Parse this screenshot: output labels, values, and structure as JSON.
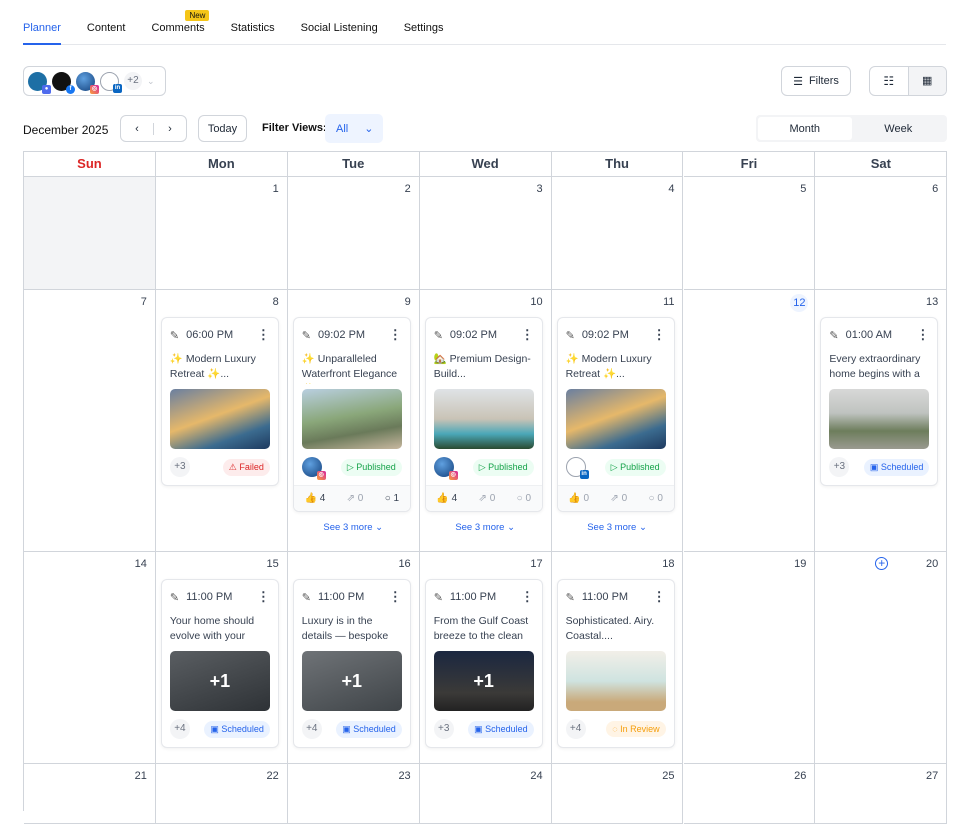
{
  "tabs": [
    {
      "label": "Planner",
      "active": true
    },
    {
      "label": "Content"
    },
    {
      "label": "Comments",
      "badge": "New"
    },
    {
      "label": "Statistics"
    },
    {
      "label": "Social Listening"
    },
    {
      "label": "Settings"
    }
  ],
  "accounts": {
    "more": "+2"
  },
  "toolbar": {
    "filters": "Filters",
    "month_label": "December 2025",
    "today": "Today",
    "filter_views_label": "Filter Views:",
    "filter_views_value": "All",
    "view_month": "Month",
    "view_week": "Week"
  },
  "weekdays": [
    "Sun",
    "Mon",
    "Tue",
    "Wed",
    "Thu",
    "Fri",
    "Sat"
  ],
  "colors": {
    "accent": "#2563eb",
    "sunday": "#dc2626"
  },
  "weeks": [
    {
      "days": [
        {
          "n": ""
        },
        {
          "n": "1"
        },
        {
          "n": "2"
        },
        {
          "n": "3"
        },
        {
          "n": "4"
        },
        {
          "n": "5"
        },
        {
          "n": "6"
        }
      ]
    },
    {
      "days": [
        {
          "n": "7"
        },
        {
          "n": "8",
          "posts": [
            {
              "time": "06:00 PM",
              "text": "✨ Modern Luxury Retreat ✨...",
              "img": "linear-gradient(160deg,#6a7fa0 0%,#e6b86a 45%,#3b6b8f 75%,#1e3a5f 100%)",
              "count": "+3",
              "status": "Failed"
            }
          ]
        },
        {
          "n": "9",
          "posts": [
            {
              "time": "09:02 PM",
              "text": "✨ Unparalleled Waterfront Elegance ✨...",
              "img": "linear-gradient(170deg,#b9cfe0 0%,#8aa77a 45%,#6a7a5a 70%,#c8b8a0 100%)",
              "avatar": "ig",
              "status": "Published",
              "stats": {
                "likes": "4",
                "shares": "0",
                "comments": "1"
              }
            }
          ],
          "see_more": "See 3 more"
        },
        {
          "n": "10",
          "posts": [
            {
              "time": "09:02 PM",
              "text": "🏡 Premium Design-Build...",
              "img": "linear-gradient(180deg,#dfe3e6 0%,#c9c3b6 50%,#4aa7b8 75%,#2a4a30 100%)",
              "avatar": "ig",
              "status": "Published",
              "stats": {
                "likes": "4",
                "shares": "0",
                "comments": "0"
              }
            }
          ],
          "see_more": "See 3 more"
        },
        {
          "n": "11",
          "posts": [
            {
              "time": "09:02 PM",
              "text": "✨ Modern Luxury Retreat ✨...",
              "img": "linear-gradient(160deg,#6a7fa0 0%,#e6b86a 45%,#3b6b8f 75%,#1e3a5f 100%)",
              "avatar": "in",
              "status": "Published",
              "stats": {
                "likes": "0",
                "shares": "0",
                "comments": "0"
              }
            }
          ],
          "see_more": "See 3 more"
        },
        {
          "n": "12",
          "today": true
        },
        {
          "n": "13",
          "posts": [
            {
              "time": "01:00 AM",
              "text": "Every extraordinary home begins with a visi...",
              "img": "linear-gradient(180deg,#d8d8d8 0%,#bfc3c0 40%,#6d7d5c 70%,#9a9a90 100%)",
              "count": "+3",
              "status": "Scheduled"
            }
          ]
        }
      ]
    },
    {
      "days": [
        {
          "n": "14"
        },
        {
          "n": "15",
          "posts": [
            {
              "time": "11:00 PM",
              "text": "Your home should evolve with your lifestyle...",
              "img": "linear-gradient(160deg,#5a5e62,#2e3236)",
              "overlay": "+1",
              "count": "+4",
              "status": "Scheduled"
            }
          ]
        },
        {
          "n": "16",
          "posts": [
            {
              "time": "11:00 PM",
              "text": "Luxury is in the details — bespoke millwork,...",
              "img": "linear-gradient(160deg,#6f7377,#3f4448)",
              "overlay": "+1",
              "count": "+4",
              "status": "Scheduled"
            }
          ]
        },
        {
          "n": "17",
          "posts": [
            {
              "time": "11:00 PM",
              "text": "From the Gulf Coast breeze to the clean lin...",
              "img": "linear-gradient(180deg,#1b2740,#3b3a38 70%,#222)",
              "overlay": "+1",
              "count": "+3",
              "status": "Scheduled"
            }
          ]
        },
        {
          "n": "18",
          "posts": [
            {
              "time": "11:00 PM",
              "text": "Sophisticated. Airy. Coastal....",
              "img": "linear-gradient(180deg,#f2efe8,#cfe3e0 50%,#c9a97a 85%)",
              "count": "+4",
              "status": "In Review"
            }
          ]
        },
        {
          "n": "19"
        },
        {
          "n": "20",
          "add": true
        }
      ]
    },
    {
      "days": [
        {
          "n": "21"
        },
        {
          "n": "22"
        },
        {
          "n": "23"
        },
        {
          "n": "24"
        },
        {
          "n": "25"
        },
        {
          "n": "26"
        },
        {
          "n": "27"
        }
      ]
    }
  ]
}
